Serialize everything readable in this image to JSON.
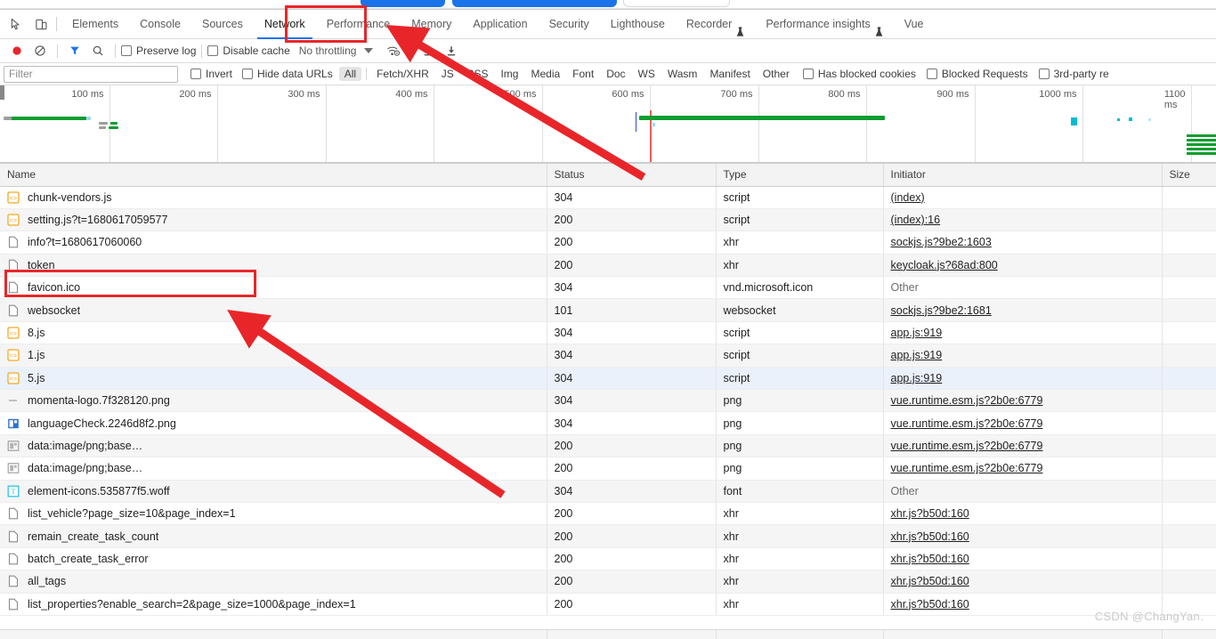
{
  "tabs": {
    "icons": [
      "inspect-element-icon",
      "device-toolbar-icon"
    ],
    "items": [
      {
        "label": "Elements",
        "active": false,
        "flask": false
      },
      {
        "label": "Console",
        "active": false,
        "flask": false
      },
      {
        "label": "Sources",
        "active": false,
        "flask": false
      },
      {
        "label": "Network",
        "active": true,
        "flask": false
      },
      {
        "label": "Performance",
        "active": false,
        "flask": false
      },
      {
        "label": "Memory",
        "active": false,
        "flask": false
      },
      {
        "label": "Application",
        "active": false,
        "flask": false
      },
      {
        "label": "Security",
        "active": false,
        "flask": false
      },
      {
        "label": "Lighthouse",
        "active": false,
        "flask": false
      },
      {
        "label": "Recorder",
        "active": false,
        "flask": true
      },
      {
        "label": "Performance insights",
        "active": false,
        "flask": true
      },
      {
        "label": "Vue",
        "active": false,
        "flask": false
      }
    ]
  },
  "toolbar": {
    "record_title": "record-button",
    "clear_title": "clear-button",
    "filter_title": "filter-button",
    "search_title": "search-button",
    "preserve_log_label": "Preserve log",
    "preserve_log_checked": false,
    "disable_cache_label": "Disable cache",
    "disable_cache_checked": false,
    "throttling_value": "No throttling",
    "wifi_title": "network-conditions-icon",
    "import_title": "import-har-icon",
    "export_title": "export-har-icon"
  },
  "filterbar": {
    "placeholder": "Filter",
    "value": "",
    "invert_label": "Invert",
    "invert_checked": false,
    "hide_data_urls_label": "Hide data URLs",
    "hide_data_urls_checked": false,
    "resource_types": [
      "All",
      "Fetch/XHR",
      "JS",
      "CSS",
      "Img",
      "Media",
      "Font",
      "Doc",
      "WS",
      "Wasm",
      "Manifest",
      "Other"
    ],
    "selected_resource_type": "All",
    "has_blocked_cookies_label": "Has blocked cookies",
    "has_blocked_cookies_checked": false,
    "blocked_requests_label": "Blocked Requests",
    "blocked_requests_checked": false,
    "third_party_label": "3rd-party re",
    "third_party_checked": false
  },
  "overview": {
    "tick_labels": [
      "100 ms",
      "200 ms",
      "300 ms",
      "400 ms",
      "500 ms",
      "600 ms",
      "700 ms",
      "800 ms",
      "900 ms",
      "1000 ms",
      "1100 ms"
    ]
  },
  "table": {
    "columns": [
      "Name",
      "Status",
      "Type",
      "Initiator",
      "Size"
    ],
    "rows": [
      {
        "name": "chunk-vendors.js",
        "icon": "script-icon",
        "status": "304",
        "type": "script",
        "initiator": "(index)",
        "initiator_link": true,
        "size": "",
        "selected": false
      },
      {
        "name": "setting.js?t=1680617059577",
        "icon": "script-icon",
        "status": "200",
        "type": "script",
        "initiator": "(index):16",
        "initiator_link": true,
        "size": "",
        "selected": false
      },
      {
        "name": "info?t=1680617060060",
        "icon": "generic-doc-icon",
        "status": "200",
        "type": "xhr",
        "initiator": "sockjs.js?9be2:1603",
        "initiator_link": true,
        "size": "",
        "selected": false
      },
      {
        "name": "token",
        "icon": "generic-doc-icon",
        "status": "200",
        "type": "xhr",
        "initiator": "keycloak.js?68ad:800",
        "initiator_link": true,
        "size": "",
        "selected": false
      },
      {
        "name": "favicon.ico",
        "icon": "generic-doc-icon",
        "status": "304",
        "type": "vnd.microsoft.icon",
        "initiator": "Other",
        "initiator_link": false,
        "size": "",
        "selected": false
      },
      {
        "name": "websocket",
        "icon": "generic-doc-icon",
        "status": "101",
        "type": "websocket",
        "initiator": "sockjs.js?9be2:1681",
        "initiator_link": true,
        "size": "",
        "selected": false
      },
      {
        "name": "8.js",
        "icon": "script-icon",
        "status": "304",
        "type": "script",
        "initiator": "app.js:919",
        "initiator_link": true,
        "size": "",
        "selected": false
      },
      {
        "name": "1.js",
        "icon": "script-icon",
        "status": "304",
        "type": "script",
        "initiator": "app.js:919",
        "initiator_link": true,
        "size": "",
        "selected": false
      },
      {
        "name": "5.js",
        "icon": "script-icon",
        "status": "304",
        "type": "script",
        "initiator": "app.js:919",
        "initiator_link": true,
        "size": "",
        "selected": true
      },
      {
        "name": "momenta-logo.7f328120.png",
        "icon": "dash-icon",
        "status": "304",
        "type": "png",
        "initiator": "vue.runtime.esm.js?2b0e:6779",
        "initiator_link": true,
        "size": "",
        "selected": false
      },
      {
        "name": "languageCheck.2246d8f2.png",
        "icon": "image-blue-icon",
        "status": "304",
        "type": "png",
        "initiator": "vue.runtime.esm.js?2b0e:6779",
        "initiator_link": true,
        "size": "",
        "selected": false
      },
      {
        "name": "data:image/png;base…",
        "icon": "image-gray-icon",
        "status": "200",
        "type": "png",
        "initiator": "vue.runtime.esm.js?2b0e:6779",
        "initiator_link": true,
        "size": "",
        "selected": false,
        "dim": true
      },
      {
        "name": "data:image/png;base…",
        "icon": "image-gray-icon",
        "status": "200",
        "type": "png",
        "initiator": "vue.runtime.esm.js?2b0e:6779",
        "initiator_link": true,
        "size": "",
        "selected": false,
        "dim": true
      },
      {
        "name": "element-icons.535877f5.woff",
        "icon": "font-icon",
        "status": "304",
        "type": "font",
        "initiator": "Other",
        "initiator_link": false,
        "size": "",
        "selected": false
      },
      {
        "name": "list_vehicle?page_size=10&page_index=1",
        "icon": "generic-doc-icon",
        "status": "200",
        "type": "xhr",
        "initiator": "xhr.js?b50d:160",
        "initiator_link": true,
        "size": "",
        "selected": false
      },
      {
        "name": "remain_create_task_count",
        "icon": "generic-doc-icon",
        "status": "200",
        "type": "xhr",
        "initiator": "xhr.js?b50d:160",
        "initiator_link": true,
        "size": "",
        "selected": false
      },
      {
        "name": "batch_create_task_error",
        "icon": "generic-doc-icon",
        "status": "200",
        "type": "xhr",
        "initiator": "xhr.js?b50d:160",
        "initiator_link": true,
        "size": "",
        "selected": false
      },
      {
        "name": "all_tags",
        "icon": "generic-doc-icon",
        "status": "200",
        "type": "xhr",
        "initiator": "xhr.js?b50d:160",
        "initiator_link": true,
        "size": "",
        "selected": false
      },
      {
        "name": "list_properties?enable_search=2&page_size=1000&page_index=1",
        "icon": "generic-doc-icon",
        "status": "200",
        "type": "xhr",
        "initiator": "xhr.js?b50d:160",
        "initiator_link": true,
        "size": "",
        "selected": false
      }
    ]
  },
  "annotations": {
    "network_tab_box": "highlight around Network tab",
    "token_row_box": "highlight around token request row",
    "arrow_to_network": "arrow pointing at Network tab",
    "arrow_to_token": "arrow pointing at token row"
  },
  "watermark": {
    "text": "CSDN @ChangYan."
  },
  "colors": {
    "accent": "#1a73e8",
    "annotation": "#e8262a",
    "record": "#e8262a",
    "timeline_green": "#0f9d2f",
    "selected_row": "#eaf1fb"
  }
}
